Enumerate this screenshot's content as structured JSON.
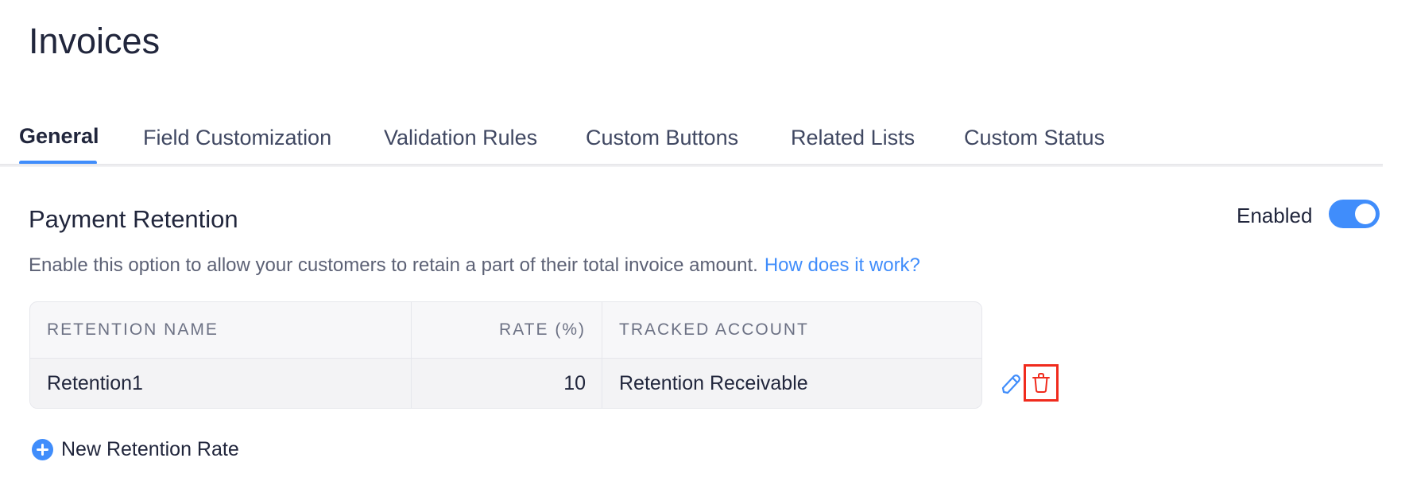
{
  "page": {
    "title": "Invoices"
  },
  "tabs": [
    {
      "label": "General",
      "active": true
    },
    {
      "label": "Field Customization",
      "active": false
    },
    {
      "label": "Validation Rules",
      "active": false
    },
    {
      "label": "Custom Buttons",
      "active": false
    },
    {
      "label": "Related Lists",
      "active": false
    },
    {
      "label": "Custom Status",
      "active": false
    }
  ],
  "section": {
    "title": "Payment Retention",
    "toggle_label": "Enabled",
    "toggle_on": true,
    "description": "Enable this option to allow your customers to retain a part of their total invoice amount.",
    "help_link": "How does it work?"
  },
  "table": {
    "columns": [
      "RETENTION NAME",
      "RATE (%)",
      "TRACKED ACCOUNT"
    ],
    "rows": [
      {
        "name": "Retention1",
        "rate": "10",
        "account": "Retention Receivable"
      }
    ]
  },
  "actions": {
    "edit_icon": "pencil-icon",
    "delete_icon": "trash-icon",
    "add_label": "New Retention Rate",
    "add_icon": "plus-circle-icon"
  },
  "colors": {
    "accent": "#408dfb",
    "danger": "#f02b1d",
    "text": "#21263c"
  }
}
